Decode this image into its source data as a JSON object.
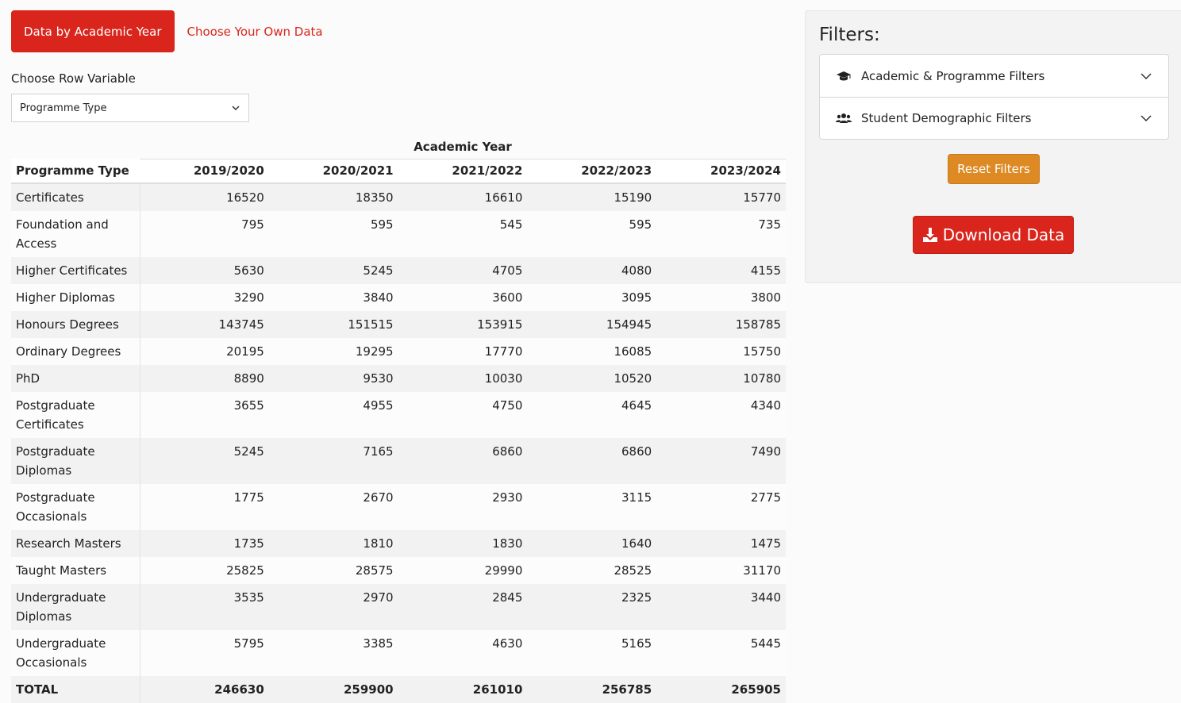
{
  "tabs": {
    "active": "Data by Academic Year",
    "other": "Choose Your Own Data"
  },
  "row_variable": {
    "label": "Choose Row Variable",
    "selected": "Programme Type"
  },
  "table": {
    "group_header": "Academic Year",
    "row_header": "Programme Type",
    "columns": [
      "2019/2020",
      "2020/2021",
      "2021/2022",
      "2022/2023",
      "2023/2024"
    ],
    "rows": [
      {
        "label": "Certificates",
        "values": [
          "16520",
          "18350",
          "16610",
          "15190",
          "15770"
        ]
      },
      {
        "label": "Foundation and Access",
        "values": [
          "795",
          "595",
          "545",
          "595",
          "735"
        ]
      },
      {
        "label": "Higher Certificates",
        "values": [
          "5630",
          "5245",
          "4705",
          "4080",
          "4155"
        ]
      },
      {
        "label": "Higher Diplomas",
        "values": [
          "3290",
          "3840",
          "3600",
          "3095",
          "3800"
        ]
      },
      {
        "label": "Honours Degrees",
        "values": [
          "143745",
          "151515",
          "153915",
          "154945",
          "158785"
        ]
      },
      {
        "label": "Ordinary Degrees",
        "values": [
          "20195",
          "19295",
          "17770",
          "16085",
          "15750"
        ]
      },
      {
        "label": "PhD",
        "values": [
          "8890",
          "9530",
          "10030",
          "10520",
          "10780"
        ]
      },
      {
        "label": "Postgraduate Certificates",
        "values": [
          "3655",
          "4955",
          "4750",
          "4645",
          "4340"
        ]
      },
      {
        "label": "Postgraduate Diplomas",
        "values": [
          "5245",
          "7165",
          "6860",
          "6860",
          "7490"
        ]
      },
      {
        "label": "Postgraduate Occasionals",
        "values": [
          "1775",
          "2670",
          "2930",
          "3115",
          "2775"
        ]
      },
      {
        "label": "Research Masters",
        "values": [
          "1735",
          "1810",
          "1830",
          "1640",
          "1475"
        ]
      },
      {
        "label": "Taught Masters",
        "values": [
          "25825",
          "28575",
          "29990",
          "28525",
          "31170"
        ]
      },
      {
        "label": "Undergraduate Diplomas",
        "values": [
          "3535",
          "2970",
          "2845",
          "2325",
          "3440"
        ]
      },
      {
        "label": "Undergraduate Occasionals",
        "values": [
          "5795",
          "3385",
          "4630",
          "5165",
          "5445"
        ]
      }
    ],
    "total": {
      "label": "TOTAL",
      "values": [
        "246630",
        "259900",
        "261010",
        "256785",
        "265905"
      ]
    }
  },
  "filters": {
    "title": "Filters:",
    "sections": [
      {
        "label": "Academic & Programme Filters",
        "icon": "graduation-cap-icon"
      },
      {
        "label": "Student Demographic Filters",
        "icon": "users-icon"
      }
    ],
    "reset_label": "Reset Filters",
    "download_label": "Download Data"
  },
  "colors": {
    "brand_red": "#d9251c",
    "reset_orange": "#dd8a24"
  }
}
